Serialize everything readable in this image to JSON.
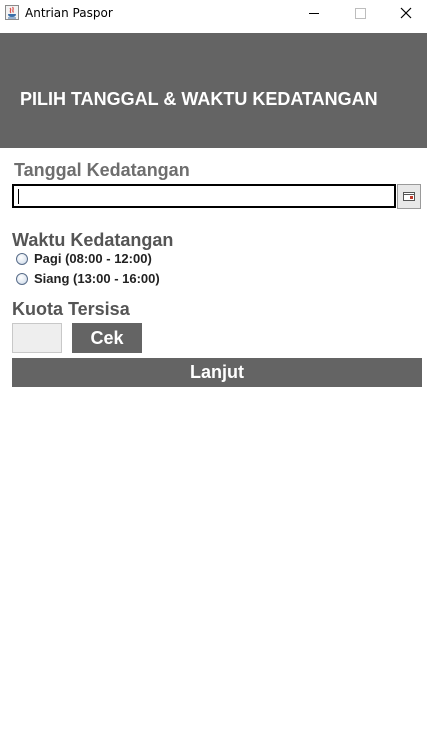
{
  "window": {
    "title": "Antrian Paspor",
    "minimize_symbol": "—",
    "maximize_symbol": "☐",
    "close_symbol": "✕"
  },
  "header": {
    "title": "PILIH TANGGAL & WAKTU KEDATANGAN"
  },
  "date": {
    "label": "Tanggal Kedatangan",
    "value": "",
    "picker_icon": "calendar-icon"
  },
  "time": {
    "label": "Waktu Kedatangan",
    "options": [
      {
        "label": "Pagi (08:00 - 12:00)",
        "selected": false
      },
      {
        "label": "Siang (13:00 - 16:00)",
        "selected": false
      }
    ]
  },
  "quota": {
    "label": "Kuota Tersisa",
    "value": "",
    "check_label": "Cek"
  },
  "next_label": "Lanjut",
  "colors": {
    "header_bg": "#646464",
    "button_bg": "#646464",
    "label_gray": "#6e6e6e"
  }
}
